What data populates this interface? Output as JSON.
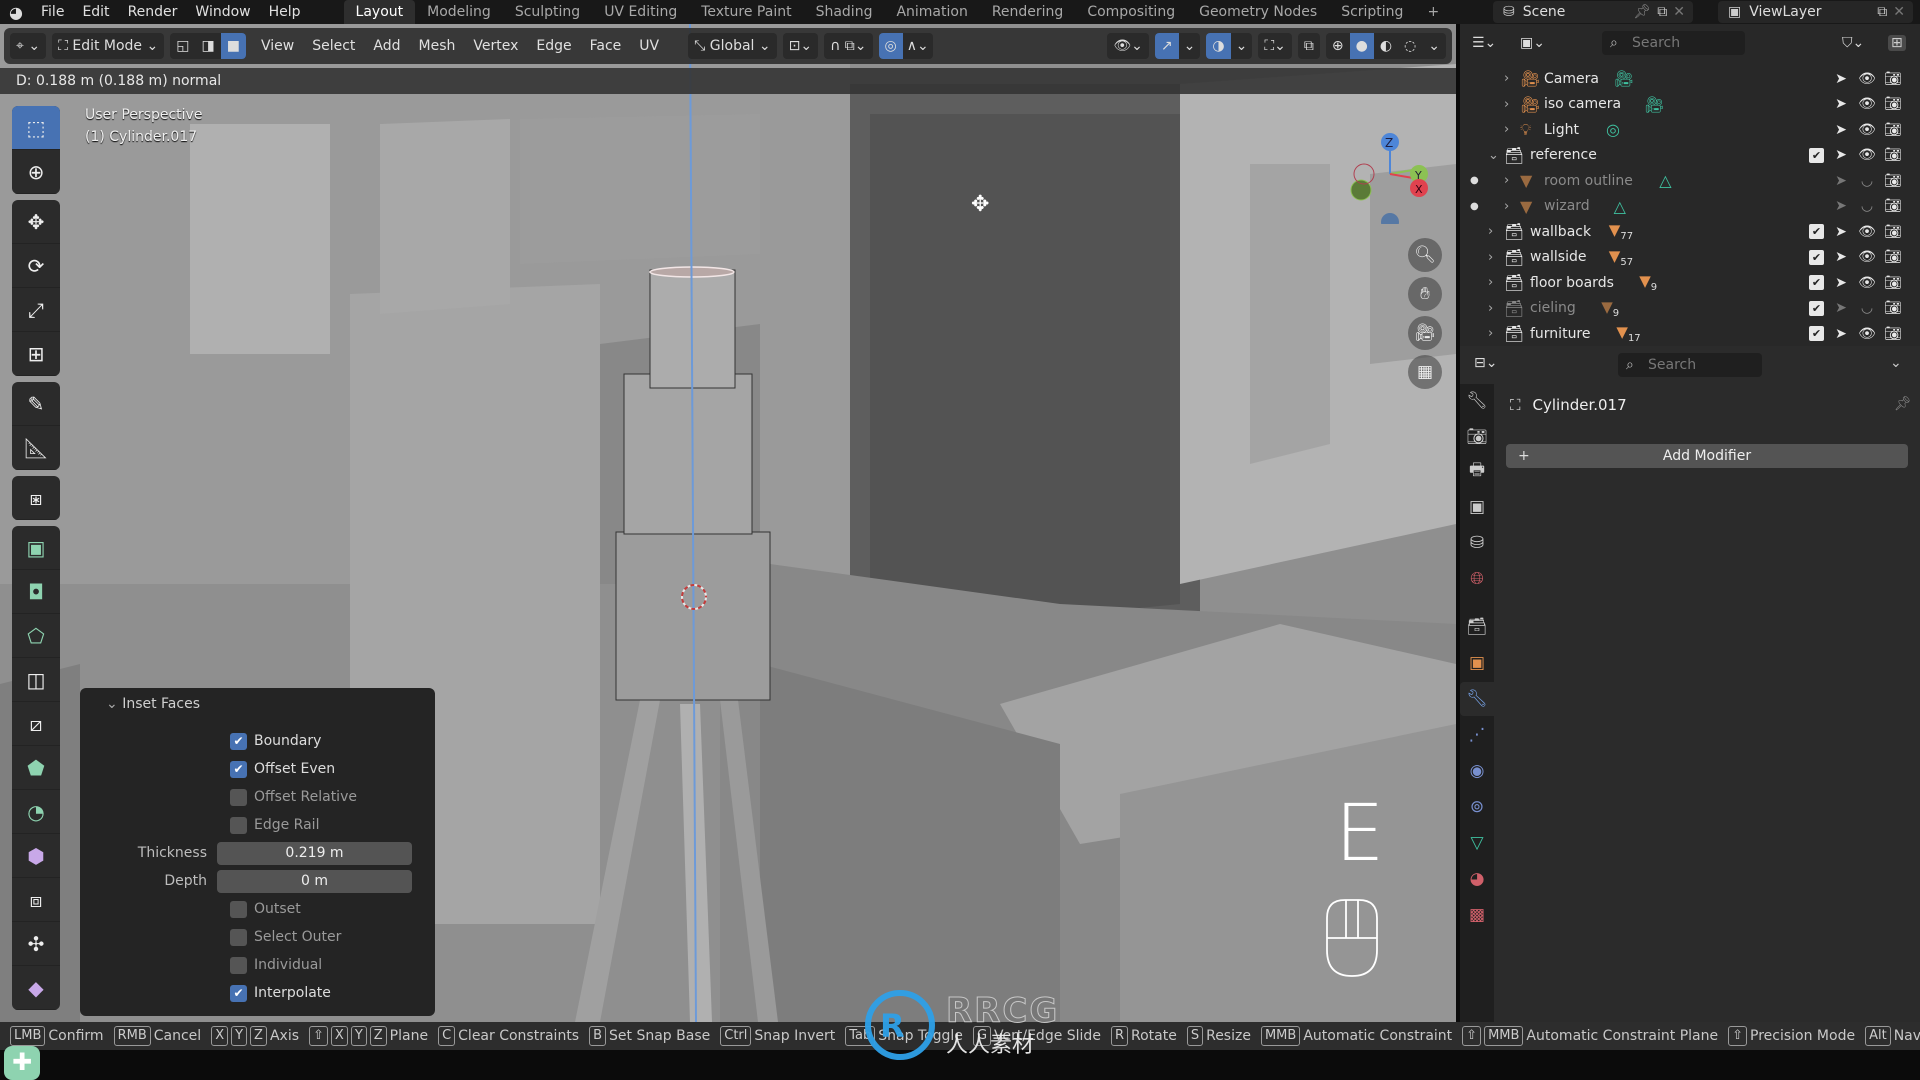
{
  "topbar": {
    "menus": [
      "File",
      "Edit",
      "Render",
      "Window",
      "Help"
    ],
    "workspace_tabs": [
      "Layout",
      "Modeling",
      "Sculpting",
      "UV Editing",
      "Texture Paint",
      "Shading",
      "Animation",
      "Rendering",
      "Compositing",
      "Geometry Nodes",
      "Scripting"
    ],
    "active_tab": "Layout",
    "add_tab": "+",
    "scene": "Scene",
    "view_layer": "ViewLayer"
  },
  "viewport": {
    "mode": "Edit Mode",
    "menus": [
      "View",
      "Select",
      "Add",
      "Mesh",
      "Vertex",
      "Edge",
      "Face",
      "UV"
    ],
    "transform_orientation": "Global",
    "operator_status": "D: 0.188 m (0.188 m) normal",
    "view_name": "User Perspective",
    "object_label": "(1) Cylinder.017",
    "key_pressed": "E",
    "gizmo_axes": [
      "Z",
      "Y",
      "X"
    ]
  },
  "toolbar": {
    "tools": [
      "select-box",
      "cursor",
      "move",
      "rotate",
      "scale",
      "transform",
      "annotate",
      "measure",
      "add-cube",
      "extrude-region",
      "inset-faces",
      "bevel",
      "loop-cut",
      "knife",
      "poly-build",
      "spin",
      "smooth",
      "edge-slide",
      "shrink-fatten",
      "shear"
    ],
    "active": "select-box"
  },
  "inset_panel": {
    "title": "Inset Faces",
    "checkboxes": [
      {
        "label": "Boundary",
        "checked": true
      },
      {
        "label": "Offset Even",
        "checked": true
      },
      {
        "label": "Offset Relative",
        "checked": false
      },
      {
        "label": "Edge Rail",
        "checked": false
      }
    ],
    "thickness_label": "Thickness",
    "thickness_value": "0.219 m",
    "depth_label": "Depth",
    "depth_value": "0 m",
    "checkboxes2": [
      {
        "label": "Outset",
        "checked": false
      },
      {
        "label": "Select Outer",
        "checked": false
      },
      {
        "label": "Individual",
        "checked": false
      },
      {
        "label": "Interpolate",
        "checked": true
      }
    ]
  },
  "outliner": {
    "search_placeholder": "Search",
    "rows": [
      {
        "name": "Camera",
        "type": "camera",
        "dim": false
      },
      {
        "name": "iso camera",
        "type": "camera",
        "dim": false
      },
      {
        "name": "Light",
        "type": "light",
        "dim": false
      },
      {
        "name": "reference",
        "type": "collection",
        "dim": false,
        "expanded": true
      },
      {
        "name": "room outline",
        "type": "mesh",
        "dim": true
      },
      {
        "name": "wizard",
        "type": "mesh",
        "dim": true
      },
      {
        "name": "wallback",
        "type": "collection",
        "dim": false,
        "count": "77"
      },
      {
        "name": "wallside",
        "type": "collection",
        "dim": false,
        "count": "57"
      },
      {
        "name": "floor boards",
        "type": "collection",
        "dim": false,
        "count": "9"
      },
      {
        "name": "cieling",
        "type": "collection",
        "dim": true,
        "count": "9"
      },
      {
        "name": "furniture",
        "type": "collection",
        "dim": false,
        "count": "17"
      }
    ]
  },
  "properties": {
    "search_placeholder": "Search",
    "object_name": "Cylinder.017",
    "add_modifier": "Add Modifier",
    "active_tab": "modifiers",
    "tabs": [
      "tool",
      "render",
      "output",
      "view-layer",
      "scene",
      "world",
      "collection",
      "object",
      "modifiers",
      "particles",
      "physics",
      "constraints",
      "data",
      "material",
      "texture"
    ]
  },
  "statusbar": {
    "items": [
      {
        "keys": [
          "LMB"
        ],
        "label": "Confirm"
      },
      {
        "keys": [
          "RMB"
        ],
        "label": "Cancel"
      },
      {
        "keys": [
          "X",
          "Y",
          "Z"
        ],
        "label": "Axis"
      },
      {
        "keys": [
          "⇧",
          "X",
          "Y",
          "Z"
        ],
        "label": "Plane"
      },
      {
        "keys": [
          "C"
        ],
        "label": "Clear Constraints"
      },
      {
        "keys": [
          "B"
        ],
        "label": "Set Snap Base"
      },
      {
        "keys": [
          "Ctrl"
        ],
        "label": "Snap Invert"
      },
      {
        "keys": [
          "Tab"
        ],
        "label": "Snap Toggle"
      },
      {
        "keys": [
          "G"
        ],
        "label": "Vert/Edge Slide"
      },
      {
        "keys": [
          "R"
        ],
        "label": "Rotate"
      },
      {
        "keys": [
          "S"
        ],
        "label": "Resize"
      },
      {
        "keys": [
          "MMB"
        ],
        "label": "Automatic Constraint"
      },
      {
        "keys": [
          "⇧",
          "MMB"
        ],
        "label": "Automatic Constraint Plane"
      },
      {
        "keys": [
          "⇧"
        ],
        "label": "Precision Mode"
      },
      {
        "keys": [
          "Alt"
        ],
        "label": "Navi"
      }
    ]
  },
  "watermark": {
    "brand": "RRCG",
    "sub": "人人素材"
  },
  "colors": {
    "accent": "#4772b3",
    "collection_orange": "#e2914e",
    "data_green": "#3fc1a0"
  }
}
